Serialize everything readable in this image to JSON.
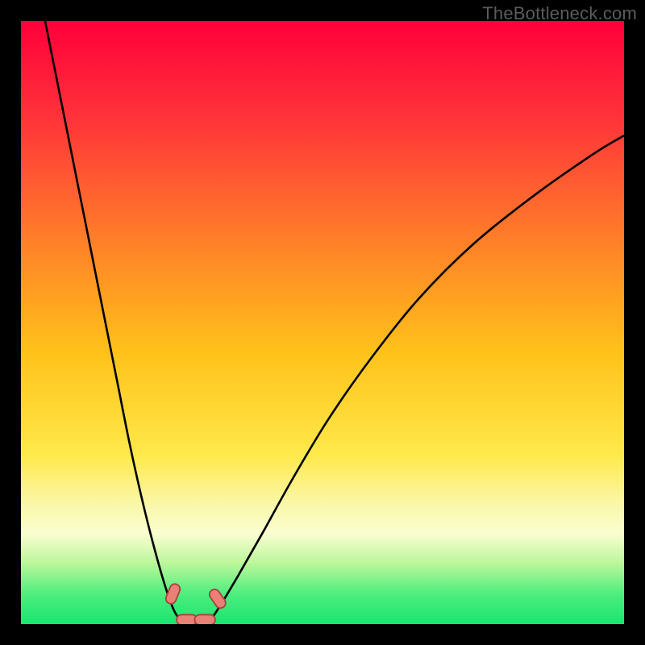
{
  "watermark": "TheBottleneck.com",
  "chart_data": {
    "type": "line",
    "title": "",
    "xlabel": "",
    "ylabel": "",
    "xlim": [
      0,
      100
    ],
    "ylim": [
      0,
      100
    ],
    "grid": false,
    "gradient_stops": [
      {
        "pct": 0,
        "color": "#ff003a"
      },
      {
        "pct": 15,
        "color": "#ff2f3a"
      },
      {
        "pct": 35,
        "color": "#ff7a2a"
      },
      {
        "pct": 55,
        "color": "#ffc21a"
      },
      {
        "pct": 72,
        "color": "#ffe94a"
      },
      {
        "pct": 80,
        "color": "#faf7a8"
      },
      {
        "pct": 85,
        "color": "#fafed0"
      },
      {
        "pct": 90,
        "color": "#b9f79a"
      },
      {
        "pct": 95,
        "color": "#4eee7e"
      },
      {
        "pct": 100,
        "color": "#19e56f"
      }
    ],
    "series": [
      {
        "name": "left-curve",
        "x": [
          4,
          6,
          8,
          10,
          12,
          14,
          16,
          18,
          20,
          22,
          24,
          25.5,
          27
        ],
        "y": [
          100,
          90,
          80,
          70,
          60,
          50,
          40,
          30,
          21,
          13,
          6,
          2,
          0
        ]
      },
      {
        "name": "right-curve",
        "x": [
          31,
          33,
          36,
          40,
          45,
          51,
          58,
          66,
          75,
          85,
          95,
          100
        ],
        "y": [
          0,
          3,
          8,
          15,
          24,
          34,
          44,
          54,
          63,
          71,
          78,
          81
        ]
      }
    ],
    "markers": [
      {
        "name": "marker-left",
        "x": 25.2,
        "y": 5.0,
        "rotation": -68
      },
      {
        "name": "marker-bottom-left",
        "x": 27.5,
        "y": 0.7,
        "rotation": 0
      },
      {
        "name": "marker-bottom-right",
        "x": 30.5,
        "y": 0.7,
        "rotation": 0
      },
      {
        "name": "marker-right",
        "x": 32.6,
        "y": 4.2,
        "rotation": 55
      }
    ],
    "marker_style": {
      "fill": "#e98176",
      "stroke": "#a8443f",
      "width_pct": 3.4,
      "height_pct": 1.7,
      "rx_pct": 0.85
    },
    "curve_stroke": "#000000"
  }
}
